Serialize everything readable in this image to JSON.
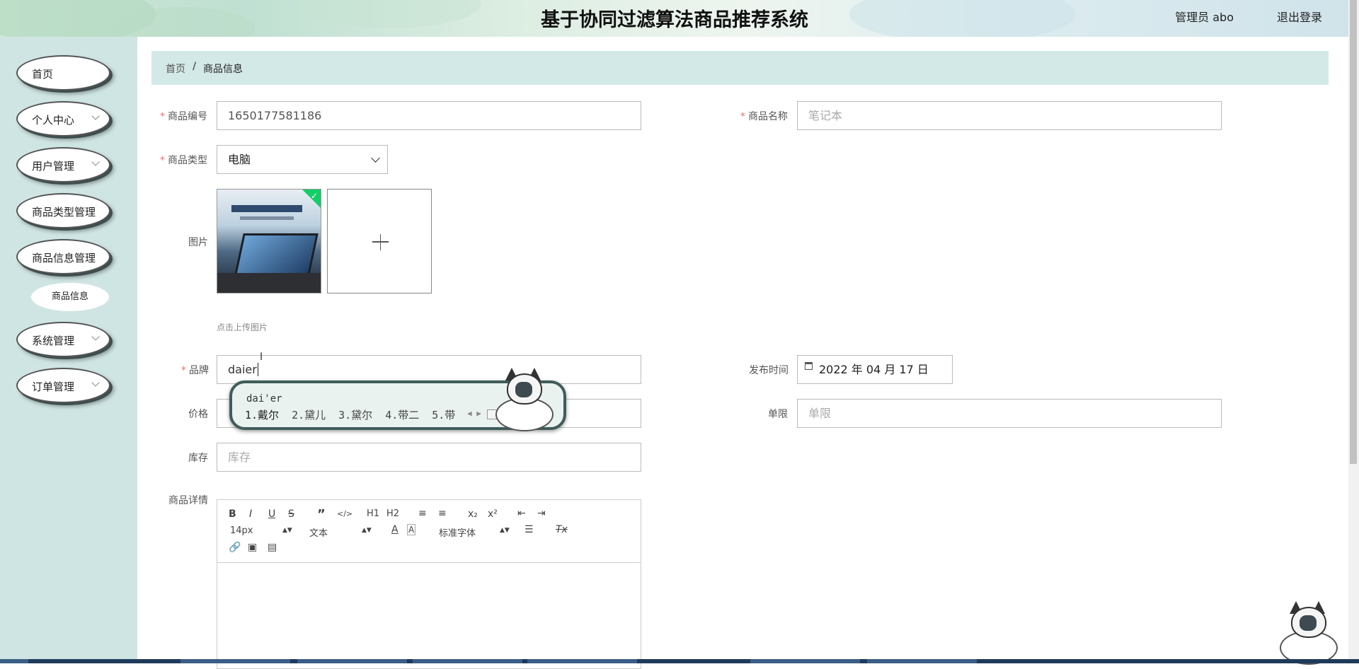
{
  "header": {
    "title": "基于协同过滤算法商品推荐系统",
    "admin_label": "管理员 abo",
    "logout": "退出登录"
  },
  "sidebar": {
    "items": [
      {
        "label": "首页",
        "has_chevron": false
      },
      {
        "label": "个人中心",
        "has_chevron": true
      },
      {
        "label": "用户管理",
        "has_chevron": true
      },
      {
        "label": "商品类型管理",
        "has_chevron": false
      },
      {
        "label": "商品信息管理",
        "has_chevron": false
      },
      {
        "label": "系统管理",
        "has_chevron": true
      },
      {
        "label": "订单管理",
        "has_chevron": true
      }
    ],
    "subitem": "商品信息"
  },
  "breadcrumb": {
    "home": "首页",
    "separator": "/",
    "current": "商品信息"
  },
  "form": {
    "required_mark": "*",
    "product_no": {
      "label": "商品编号",
      "value": "1650177581186"
    },
    "product_name": {
      "label": "商品名称",
      "placeholder": "笔记本"
    },
    "product_type": {
      "label": "商品类型",
      "value": "电脑"
    },
    "image": {
      "label": "图片",
      "hint": "点击上传图片"
    },
    "brand": {
      "label": "品牌",
      "value": "daier"
    },
    "publish_time": {
      "label": "发布时间",
      "value": "2022 年 04 月 17 日"
    },
    "price": {
      "label": "价格"
    },
    "limit": {
      "label": "单限",
      "placeholder": "单限"
    },
    "stock": {
      "label": "库存",
      "placeholder": "库存"
    },
    "details": {
      "label": "商品详情"
    }
  },
  "editor": {
    "toolbar": [
      "B",
      "I",
      "U",
      "S",
      "”",
      "</>",
      "H1",
      "H2",
      "≡",
      "≡",
      "x₂",
      "x²",
      "⇤",
      "⇥"
    ],
    "font_size": "14px",
    "format": "文本",
    "font_family": "标准字体"
  },
  "ime": {
    "pinyin": "dai'er",
    "candidates": [
      "1.戴尔",
      "2.黛儿",
      "3.黛尔",
      "4.带二",
      "5.带"
    ]
  },
  "colors": {
    "required": "#f56c6c",
    "sidebar_bg": "#cfe5e3",
    "breadcrumb_bg": "#d3e9e7",
    "upload_success": "#13ce66"
  },
  "icons": {
    "date": "calendar-icon",
    "upload": "plus-icon",
    "success": "check-icon"
  }
}
